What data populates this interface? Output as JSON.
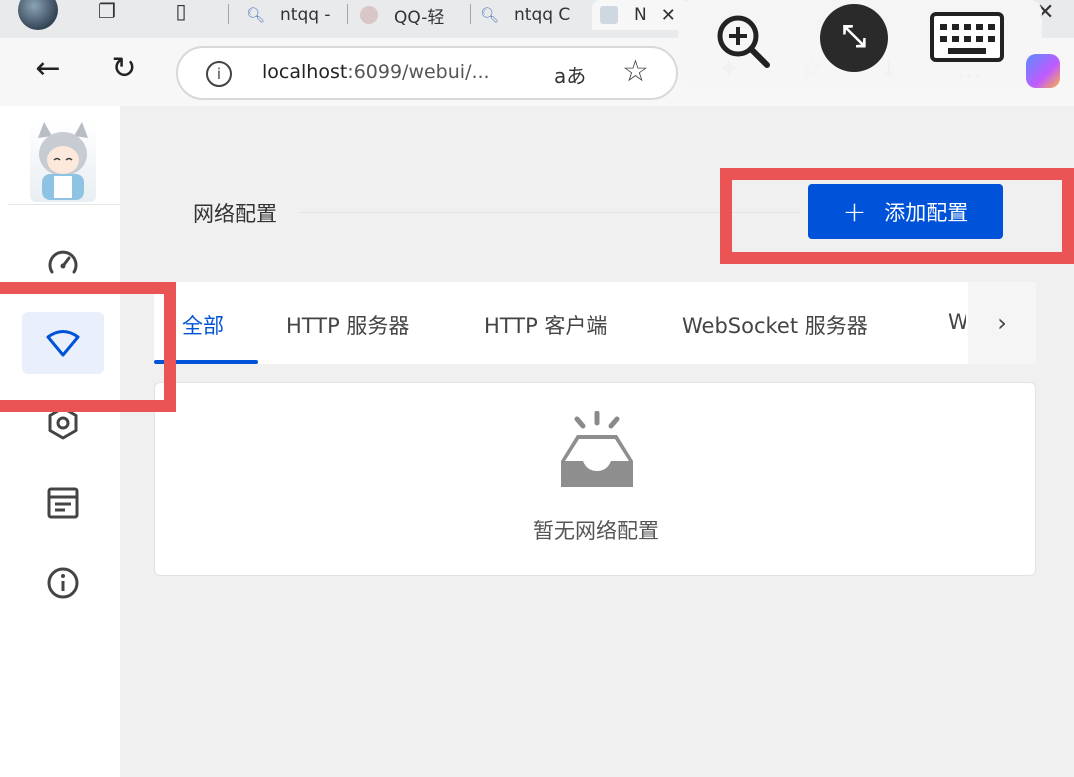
{
  "browser": {
    "tabs": [
      {
        "label": "ntqq -"
      },
      {
        "label": "QQ-轻"
      },
      {
        "label": "ntqq C"
      },
      {
        "label": "N"
      }
    ],
    "address": {
      "host": "localhost",
      "rest": ":6099/webui/...",
      "read_aloud": "aあ"
    },
    "icons": [
      "back-arrow-icon",
      "refresh-icon",
      "info-icon",
      "star-icon",
      "zoom-in-icon",
      "remote-desktop-icon",
      "keyboard-icon",
      "copilot-icon"
    ]
  },
  "sidebar": {
    "items": [
      {
        "name": "dashboard",
        "icon": "gauge-icon",
        "active": false
      },
      {
        "name": "network",
        "icon": "wifi-icon",
        "active": true
      },
      {
        "name": "settings",
        "icon": "hexagon-settings-icon",
        "active": false
      },
      {
        "name": "logs",
        "icon": "document-icon",
        "active": false
      },
      {
        "name": "about",
        "icon": "info-icon",
        "active": false
      }
    ]
  },
  "main": {
    "title": "网络配置",
    "add_button": {
      "icon": "+",
      "label": "添加配置"
    },
    "tabs": [
      {
        "label": "全部",
        "active": true
      },
      {
        "label": "HTTP 服务器",
        "active": false
      },
      {
        "label": "HTTP 客户端",
        "active": false
      },
      {
        "label": "WebSocket 服务器",
        "active": false
      },
      {
        "label": "W",
        "active": false
      }
    ],
    "scroll_icon": "›",
    "empty_text": "暂无网络配置"
  },
  "colors": {
    "accent": "#0052d9",
    "highlight": "#ea5454",
    "active_bg": "#e9f0fb"
  }
}
